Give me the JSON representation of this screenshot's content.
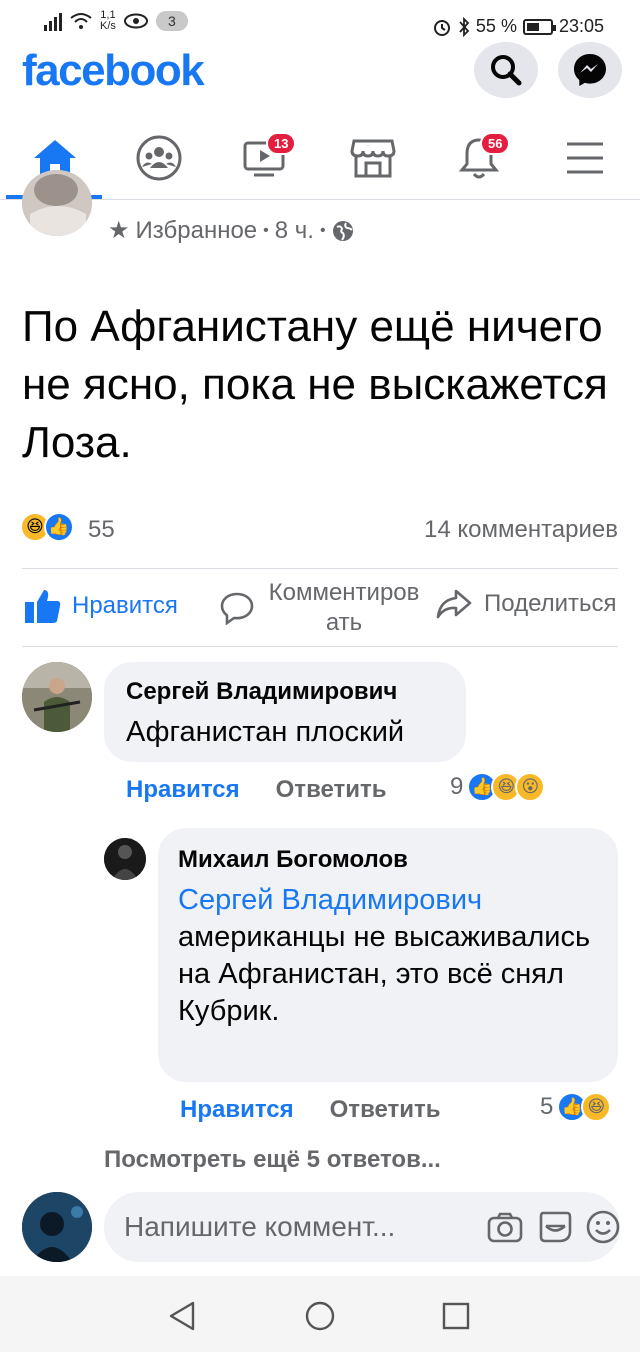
{
  "status_bar": {
    "net_speed_value": "1,1",
    "net_speed_unit": "K/s",
    "notif_count": "3",
    "battery": "55 %",
    "battery_level": 0.55,
    "time": "23:05"
  },
  "header": {
    "logo": "facebook",
    "search_icon": "search-icon",
    "messenger_icon": "messenger-icon"
  },
  "nav": {
    "items": [
      {
        "name": "home",
        "icon": "home-icon",
        "active": true
      },
      {
        "name": "groups",
        "icon": "groups-icon"
      },
      {
        "name": "watch",
        "icon": "video-icon",
        "badge": "13"
      },
      {
        "name": "marketplace",
        "icon": "shop-icon"
      },
      {
        "name": "notifications",
        "icon": "bell-icon",
        "badge": "56"
      },
      {
        "name": "menu",
        "icon": "menu-icon"
      }
    ],
    "accent": "#1877f2",
    "badge_color": "#e41e3f"
  },
  "post": {
    "audience": "Избранное",
    "time": "8 ч.",
    "dot": "•",
    "text": "По Афганистану ещё ничего не ясно, пока не выскажется Лоза.",
    "reactions_count": "55",
    "comments_count": "14 комментариев"
  },
  "actions": {
    "like": "Нравится",
    "comment": "Комментировать",
    "share": "Поделиться"
  },
  "comments": [
    {
      "author": "Сергей Владимирович",
      "text": "Афганистан плоский",
      "like": "Нравится",
      "reply": "Ответить",
      "reactions": "9"
    },
    {
      "author": "Михаил Богомолов",
      "mention": "Сергей Владимирович",
      "text": "американцы не высаживались на Афганистан, это всё снял Кубрик.",
      "like": "Нравится",
      "reply": "Ответить",
      "reactions": "5"
    }
  ],
  "more_replies": "Посмотреть ещё 5 ответов...",
  "composer": {
    "placeholder": "Напишите коммент..."
  }
}
